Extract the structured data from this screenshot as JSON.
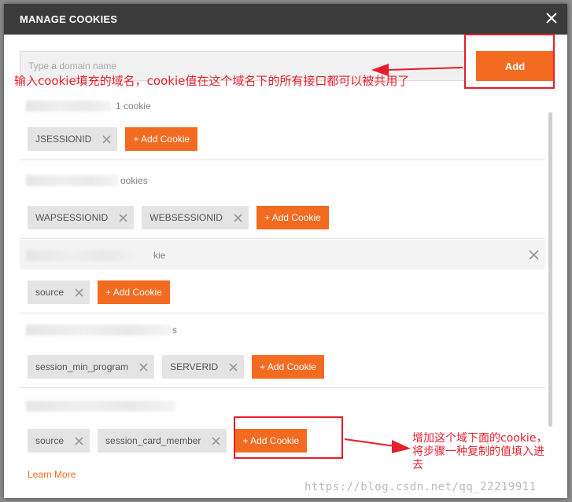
{
  "dialog": {
    "title": "MANAGE COOKIES",
    "domain_input": {
      "placeholder": "Type a domain name",
      "value": ""
    },
    "add_label": "Add",
    "learn_more": "Learn More"
  },
  "domains": [
    {
      "count_text": "1 cookie",
      "cookies": [
        "JSESSIONID"
      ]
    },
    {
      "count_text": "ookies",
      "cookies": [
        "WAPSESSIONID",
        "WEBSESSIONID"
      ]
    },
    {
      "count_text": "kie",
      "cookies": [
        "source"
      ]
    },
    {
      "count_text": "s",
      "cookies": [
        "session_min_program",
        "SERVERID"
      ]
    },
    {
      "count_text": "",
      "cookies": [
        "source",
        "session_card_member"
      ]
    }
  ],
  "add_cookie_label": "+ Add Cookie",
  "annotations": {
    "top": "输入cookie填充的域名，cookie值在这个域名下的所有接口都可以被共用了",
    "bottom": "增加这个域下面的cookie，将步骤一种复制的值填入进去"
  },
  "watermark": "https://blog.csdn.net/qq_22219911",
  "colors": {
    "accent": "#f26b21",
    "annotation": "#e81c2b",
    "titlebar": "#3b3b3b"
  }
}
